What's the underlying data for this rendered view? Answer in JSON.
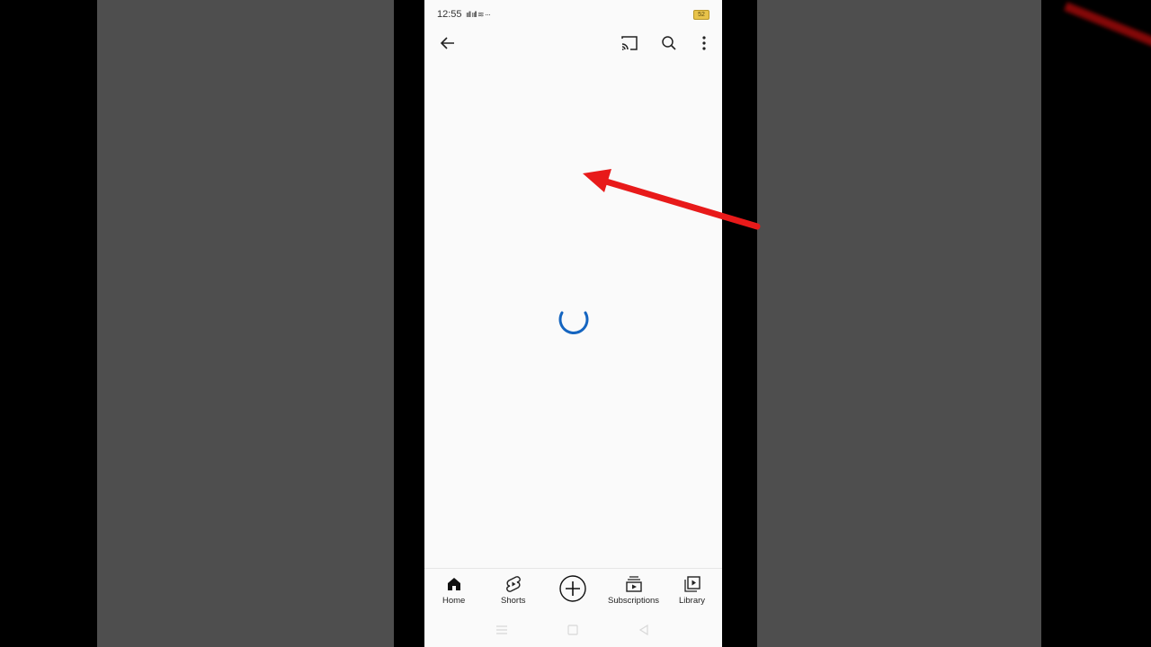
{
  "status_bar": {
    "time": "12:55",
    "signal": "ııll ııll ≋ ···",
    "battery": "52"
  },
  "toolbar": {
    "back_icon": "arrow-left-icon",
    "cast_icon": "cast-icon",
    "search_icon": "search-icon",
    "more_icon": "more-vertical-icon"
  },
  "content": {
    "state_icon": "loading-spinner-icon",
    "accent": "#1565c0"
  },
  "bottom_nav": {
    "items": [
      {
        "label": "Home",
        "icon": "home-icon"
      },
      {
        "label": "Shorts",
        "icon": "shorts-icon"
      },
      {
        "label": "",
        "icon": "create-plus-icon"
      },
      {
        "label": "Subscriptions",
        "icon": "subscriptions-icon"
      },
      {
        "label": "Library",
        "icon": "library-icon"
      }
    ]
  },
  "system_nav": {
    "menu_icon": "menu-icon",
    "home_icon": "square-icon",
    "back_icon": "triangle-back-icon"
  },
  "annotation": {
    "icon": "red-arrow-icon",
    "color": "#e81a1a"
  }
}
